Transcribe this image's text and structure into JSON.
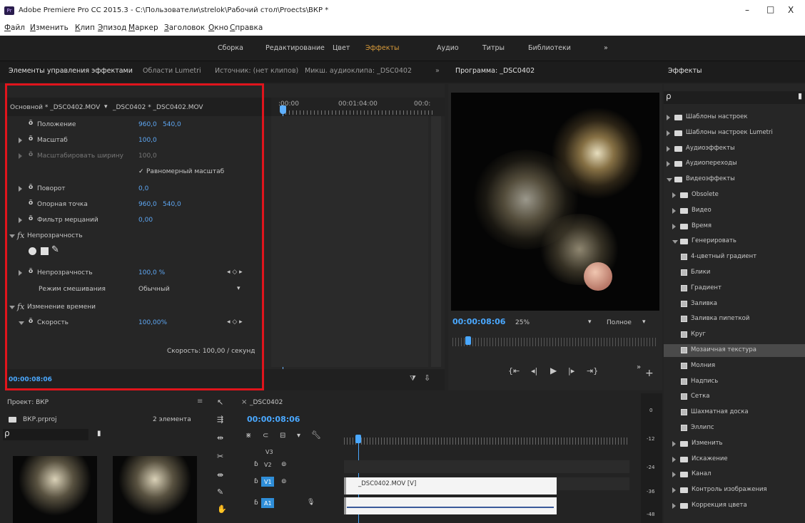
{
  "window": {
    "title": "Adobe Premiere Pro CC 2015.3 - C:\\Пользователи\\strelok\\Рабочий стол\\Proects\\ВКР *",
    "controls": [
      "–",
      "□",
      "X"
    ]
  },
  "menu": [
    "Файл",
    "Изменить",
    "Клип",
    "Эпизод",
    "Маркер",
    "Заголовок",
    "Окно",
    "Справка"
  ],
  "workspaces": [
    "Сборка",
    "Редактирование",
    "Цвет",
    "Эффекты",
    "Аудио",
    "Титры",
    "Библиотеки",
    "»"
  ],
  "tabs": {
    "effect_controls": "Элементы управления эффектами",
    "lumetri": "Области Lumetri",
    "source": "Источник: (нет клипов)",
    "audio_mixer": "Микш. аудиоклипа: _DSC0402",
    "more": "»",
    "program": "Программа: _DSC0402",
    "effects": "Эффекты"
  },
  "effect_controls": {
    "clip_selector": "Основной * _DSC0402.MOV",
    "seq_selector": "_DSC0402 * _DSC0402.MOV",
    "ruler": {
      "start": ":00:00",
      "mid": "00:01:04:00",
      "end": "00:0:"
    },
    "properties": [
      {
        "label": "Положение",
        "v1": "960,0",
        "v2": "540,0"
      },
      {
        "label": "Масштаб",
        "v1": "100,0"
      },
      {
        "label": "Масштабировать ширину",
        "v1": "100,0"
      },
      {
        "label": "Равномерный масштаб"
      },
      {
        "label": "Поворот",
        "v1": "0,0"
      },
      {
        "label": "Опорная точка",
        "v1": "960,0",
        "v2": "540,0"
      },
      {
        "label": "Фильтр мерцаний",
        "v1": "0,00"
      }
    ],
    "opacity_group": "Непрозрачность",
    "opacity": {
      "label": "Непрозрачность",
      "value": "100,0 %"
    },
    "blend": {
      "label": "Режим смешивания",
      "value": "Обычный"
    },
    "time_group": "Изменение времени",
    "speed": {
      "label": "Скорость",
      "value": "100,00%"
    },
    "speed_readout": "Скорость: 100,00 / секунд",
    "timecode": "00:00:08:06",
    "fx_glyph": "fx",
    "checkmark": "✓"
  },
  "program": {
    "timecode": "00:00:08:06",
    "zoom": "25%",
    "quality": "Полное"
  },
  "effects_panel": {
    "items": [
      {
        "label": "Шаблоны настроек",
        "level": 0
      },
      {
        "label": "Шаблоны настроек Lumetri",
        "level": 0
      },
      {
        "label": "Аудиоэффекты",
        "level": 0
      },
      {
        "label": "Аудиопереходы",
        "level": 0
      },
      {
        "label": "Видеоэффекты",
        "level": 0,
        "open": true
      },
      {
        "label": "Obsolete",
        "level": 1
      },
      {
        "label": "Видео",
        "level": 1
      },
      {
        "label": "Время",
        "level": 1
      },
      {
        "label": "Генерировать",
        "level": 1,
        "open": true
      },
      {
        "label": "4-цветный градиент",
        "level": 2
      },
      {
        "label": "Блики",
        "level": 2
      },
      {
        "label": "Градиент",
        "level": 2
      },
      {
        "label": "Заливка",
        "level": 2
      },
      {
        "label": "Заливка пипеткой",
        "level": 2
      },
      {
        "label": "Круг",
        "level": 2
      },
      {
        "label": "Мозаичная текстура",
        "level": 2,
        "selected": true
      },
      {
        "label": "Молния",
        "level": 2
      },
      {
        "label": "Надпись",
        "level": 2
      },
      {
        "label": "Сетка",
        "level": 2
      },
      {
        "label": "Шахматная доска",
        "level": 2
      },
      {
        "label": "Эллипс",
        "level": 2
      },
      {
        "label": "Изменить",
        "level": 1
      },
      {
        "label": "Искажение",
        "level": 1
      },
      {
        "label": "Канал",
        "level": 1
      },
      {
        "label": "Контроль изображения",
        "level": 1
      },
      {
        "label": "Коррекция цвета",
        "level": 1
      }
    ]
  },
  "project": {
    "title": "Проект: ВКР",
    "file": "ВКР.prproj",
    "count": "2 элемента"
  },
  "timeline": {
    "title": "_DSC0402",
    "timecode": "00:00:08:06",
    "tracks": [
      "V3",
      "V2",
      "V1",
      "A1"
    ],
    "clip_v": "_DSC0402.MOV [V]",
    "meter": [
      "0",
      "-12",
      "-24",
      "-36",
      "-48"
    ]
  },
  "colors": {
    "accent": "#4aa8ff",
    "highlight": "#e0141c",
    "panel": "#262626"
  }
}
